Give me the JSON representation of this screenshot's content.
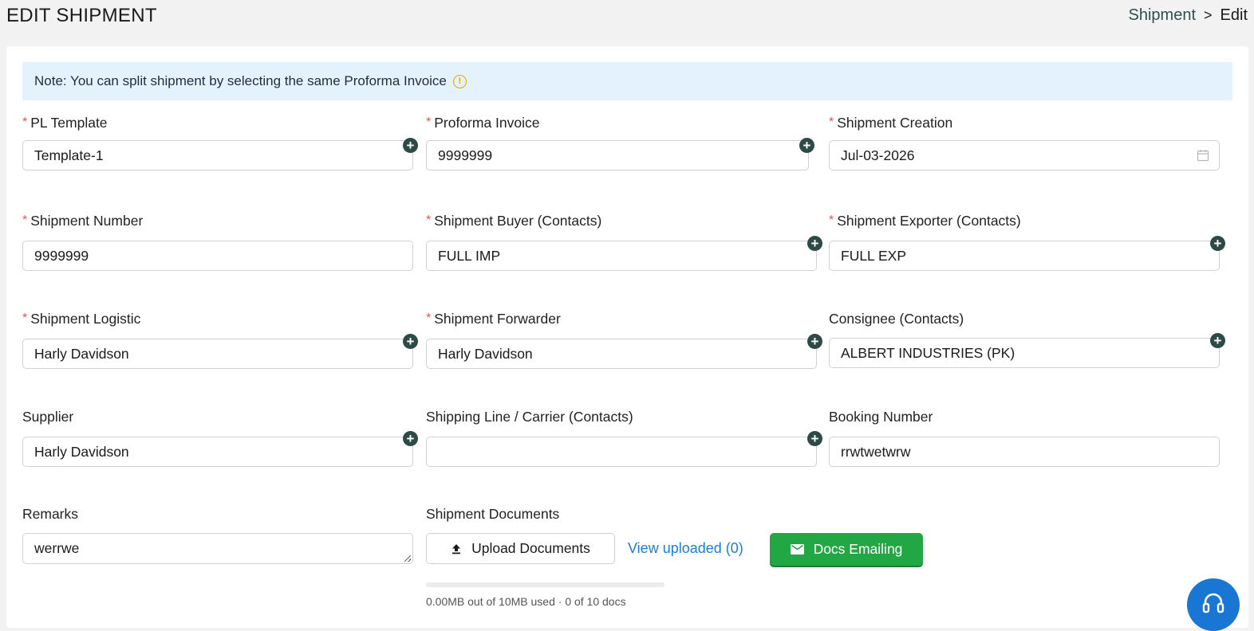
{
  "header": {
    "title": "EDIT SHIPMENT",
    "breadcrumb": {
      "parent": "Shipment",
      "separator": ">",
      "current": "Edit"
    }
  },
  "note": {
    "text": "Note: You can split shipment by selecting the same Proforma Invoice",
    "icon": "info-circle-icon"
  },
  "fields": {
    "pl_template": {
      "label": "PL Template",
      "required": true,
      "value": "Template-1"
    },
    "proforma_invoice": {
      "label": "Proforma Invoice",
      "required": true,
      "value": "9999999"
    },
    "shipment_creation": {
      "label": "Shipment Creation",
      "required": true,
      "value": "Jul-03-2026"
    },
    "shipment_number": {
      "label": "Shipment Number",
      "required": true,
      "value": "9999999"
    },
    "shipment_buyer": {
      "label": "Shipment Buyer (Contacts)",
      "required": true,
      "value": "FULL IMP"
    },
    "shipment_exporter": {
      "label": "Shipment Exporter (Contacts)",
      "required": true,
      "value": "FULL EXP"
    },
    "shipment_logistic": {
      "label": "Shipment Logistic",
      "required": true,
      "value": "Harly Davidson"
    },
    "shipment_forwarder": {
      "label": "Shipment Forwarder",
      "required": true,
      "value": "Harly Davidson"
    },
    "consignee": {
      "label": "Consignee (Contacts)",
      "required": false,
      "value": "ALBERT INDUSTRIES (PK)"
    },
    "supplier": {
      "label": "Supplier",
      "required": false,
      "value": "Harly Davidson"
    },
    "shipping_line": {
      "label": "Shipping Line / Carrier (Contacts)",
      "required": false,
      "value": ""
    },
    "booking_number": {
      "label": "Booking Number",
      "required": false,
      "value": "rrwtwetwrw"
    },
    "remarks": {
      "label": "Remarks",
      "required": false,
      "value": "werrwe"
    }
  },
  "documents": {
    "label": "Shipment Documents",
    "upload_label": "Upload Documents",
    "view_uploaded_label": "View uploaded (0)",
    "docs_emailing_label": "Docs Emailing",
    "usage_text": "0.00MB out of 10MB used · 0 of 10 docs",
    "usage_fraction": 0
  },
  "colors": {
    "accent_green": "#22a745",
    "add_button": "#2e4a47",
    "link_blue": "#1e7be0",
    "note_bg": "#e4f2fd",
    "required_star": "#e0574f",
    "fab_blue": "#1976d2"
  }
}
